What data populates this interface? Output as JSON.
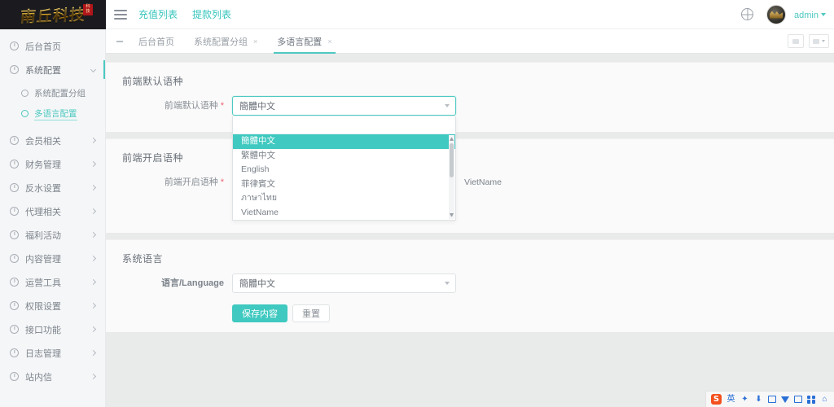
{
  "brand": {
    "logo_text": "南丘科技",
    "logo_badge": "科技"
  },
  "topnav": {
    "menu_icon": "hamburger-icon",
    "links": [
      {
        "label": "充值列表"
      },
      {
        "label": "提款列表"
      }
    ],
    "globe_icon": "globe-icon",
    "user_name": "admin",
    "user_caret": "chevron-down-icon"
  },
  "sidebar": {
    "items": [
      {
        "label": "后台首页",
        "expandable": false,
        "active": false
      },
      {
        "label": "系统配置",
        "expandable": true,
        "expanded": true,
        "children": [
          {
            "label": "系统配置分组",
            "active": false
          },
          {
            "label": "多语言配置",
            "active": true
          }
        ]
      },
      {
        "label": "会员相关",
        "expandable": true,
        "expanded": false
      },
      {
        "label": "财务管理",
        "expandable": true,
        "expanded": false
      },
      {
        "label": "反水设置",
        "expandable": true,
        "expanded": false
      },
      {
        "label": "代理相关",
        "expandable": true,
        "expanded": false
      },
      {
        "label": "福利活动",
        "expandable": true,
        "expanded": false
      },
      {
        "label": "内容管理",
        "expandable": true,
        "expanded": false
      },
      {
        "label": "运营工具",
        "expandable": true,
        "expanded": false
      },
      {
        "label": "权限设置",
        "expandable": true,
        "expanded": false
      },
      {
        "label": "接口功能",
        "expandable": true,
        "expanded": false
      },
      {
        "label": "日志管理",
        "expandable": true,
        "expanded": false
      },
      {
        "label": "站内信",
        "expandable": true,
        "expanded": false
      }
    ]
  },
  "tabbar": {
    "tabs": [
      {
        "label": "后台首页",
        "closable": false,
        "active": false
      },
      {
        "label": "系统配置分组",
        "closable": true,
        "active": false
      },
      {
        "label": "多语言配置",
        "closable": true,
        "active": true
      }
    ],
    "close_glyph": "×"
  },
  "sections": [
    {
      "title": "前端默认语种",
      "label": "前端默认语种",
      "required": true,
      "value": "簡體中文",
      "dropdown_open": true,
      "options": [
        {
          "label": "簡體中文",
          "selected": true
        },
        {
          "label": "繁體中文",
          "selected": false
        },
        {
          "label": "English",
          "selected": false
        },
        {
          "label": "菲律賓文",
          "selected": false
        },
        {
          "label": "ภาษาไทย",
          "selected": false
        },
        {
          "label": "VietName",
          "selected": false
        }
      ]
    },
    {
      "title": "前端开启语种",
      "label": "前端开启语种",
      "required": true,
      "tag_text": "VietName",
      "save_label": "保存内容",
      "reset_label": "重置"
    },
    {
      "title": "系统语言",
      "label": "语言/Language",
      "required": false,
      "value": "簡體中文",
      "save_label": "保存内容",
      "reset_label": "重置"
    }
  ],
  "colors": {
    "accent": "#3fc9c0",
    "required": "#f06272",
    "page_bg": "#e9eaea"
  },
  "browser_bar": {
    "logo": "S",
    "icons": [
      "text-icon",
      "star-icon",
      "download-icon",
      "mail-icon",
      "shirt-icon",
      "briefcase-icon",
      "grid-icon",
      "lock-icon"
    ]
  }
}
